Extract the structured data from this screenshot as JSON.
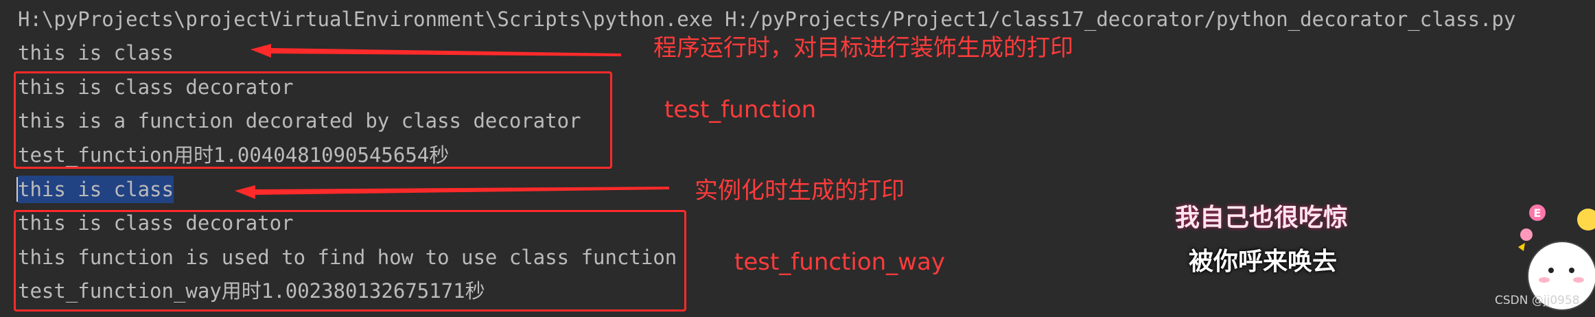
{
  "console": {
    "lines": [
      "H:\\pyProjects\\projectVirtualEnvironment\\Scripts\\python.exe H:/pyProjects/Project1/class17_decorator/python_decorator_class.py",
      "this is class",
      "this is class decorator",
      "this is a function decorated by class decorator",
      "test_function用时1.0040481090545654秒",
      "this is class",
      "this is class decorator",
      "this function is used to find how to use class function",
      "test_function_way用时1.002380132675171秒"
    ]
  },
  "annotations": {
    "runtime_note": "程序运行时，对目标进行装饰生成的打印",
    "test_function_note": "test_function",
    "instantiation_note": "实例化时生成的打印",
    "test_function_way_note": "test_function_way"
  },
  "sticker": {
    "line1": "我自己也很吃惊",
    "line2": "被你呼来唤去",
    "badge": "E"
  },
  "watermark": "CSDN @jj0958",
  "colors": {
    "background": "#2b2b2b",
    "text": "#bbbbbb",
    "annotation": "#ff2a2a",
    "selection": "#214283"
  }
}
